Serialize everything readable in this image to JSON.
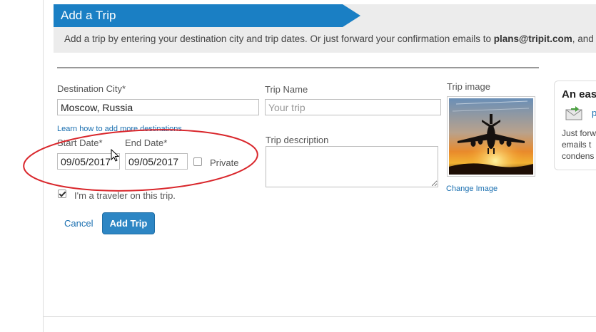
{
  "banner": {
    "title": "Add a Trip",
    "text_prefix": "Add a trip by entering your destination city and trip dates. Or just forward your confirmation emails to ",
    "email": "plans@tripit.com",
    "text_suffix": ", and we'"
  },
  "form": {
    "destination_label": "Destination City*",
    "destination_value": "Moscow, Russia",
    "trip_name_label": "Trip Name",
    "trip_name_placeholder": "Your trip",
    "more_destinations_link": "Learn how to add more destinations",
    "start_date_label": "Start Date*",
    "start_date_value": "09/05/2017",
    "end_date_label": "End Date*",
    "end_date_value": "09/05/2017",
    "private_label": "Private",
    "private_checked": false,
    "description_label": "Trip description",
    "description_value": "",
    "traveler_label": "I'm a traveler on this trip.",
    "traveler_checked": true,
    "cancel_label": "Cancel",
    "submit_label": "Add Trip"
  },
  "trip_image": {
    "label": "Trip image",
    "change_link": "Change Image",
    "icon": "airplane-sunset-photo"
  },
  "side_card": {
    "title": "An eas",
    "link_text": "p",
    "lines": [
      "Just forw",
      "emails t",
      "condens"
    ]
  },
  "colors": {
    "accent": "#1a7fc4",
    "annotation": "#d9262b"
  }
}
